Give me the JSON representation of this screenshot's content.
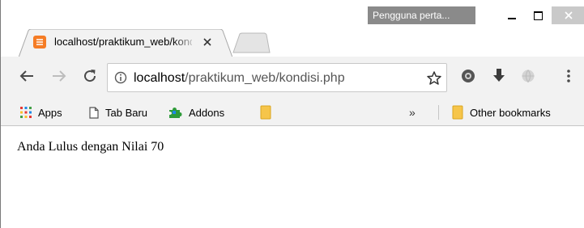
{
  "window": {
    "profile_label": "Pengguna perta...",
    "tab": {
      "title": "localhost/praktikum_web/kondisi.php"
    }
  },
  "toolbar": {
    "url_host": "localhost",
    "url_path": "/praktikum_web/kondisi.php"
  },
  "bookmarks": {
    "items": [
      {
        "label": "Apps",
        "icon": "apps-grid-icon"
      },
      {
        "label": "Tab Baru",
        "icon": "page-icon"
      },
      {
        "label": "Addons",
        "icon": "puzzle-icon"
      },
      {
        "label": "",
        "icon": "folder-icon"
      }
    ],
    "overflow": "»",
    "other": {
      "label": "Other bookmarks",
      "icon": "folder-icon"
    }
  },
  "page": {
    "message": "Anda Lulus dengan Nilai 70"
  },
  "colors": {
    "chrome_bg": "#f2f2f2",
    "profile_bg": "#8a8a8a",
    "favicon": "#f57c25",
    "folder": "#f6c54a"
  }
}
